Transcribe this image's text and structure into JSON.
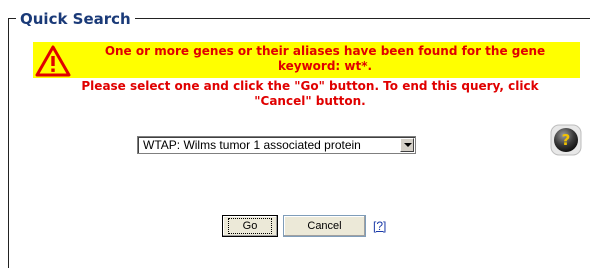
{
  "panel": {
    "title": "Quick Search"
  },
  "warning": {
    "line1": "One or more genes or their aliases have been found for the gene",
    "line2": "keyword: wt*.",
    "line3": "Please select one and click the \"Go\" button. To end this query, click",
    "line4": "\"Cancel\" button."
  },
  "gene_select": {
    "selected": "WTAP: Wilms tumor 1 associated protein"
  },
  "buttons": {
    "go": "Go",
    "cancel": "Cancel",
    "help": "[?]"
  },
  "colors": {
    "warning_bg": "#ffff00",
    "warning_text": "#e00000",
    "title": "#1a3a78"
  },
  "icons": {
    "warning": "warning-triangle-icon",
    "help": "help-question-icon"
  }
}
